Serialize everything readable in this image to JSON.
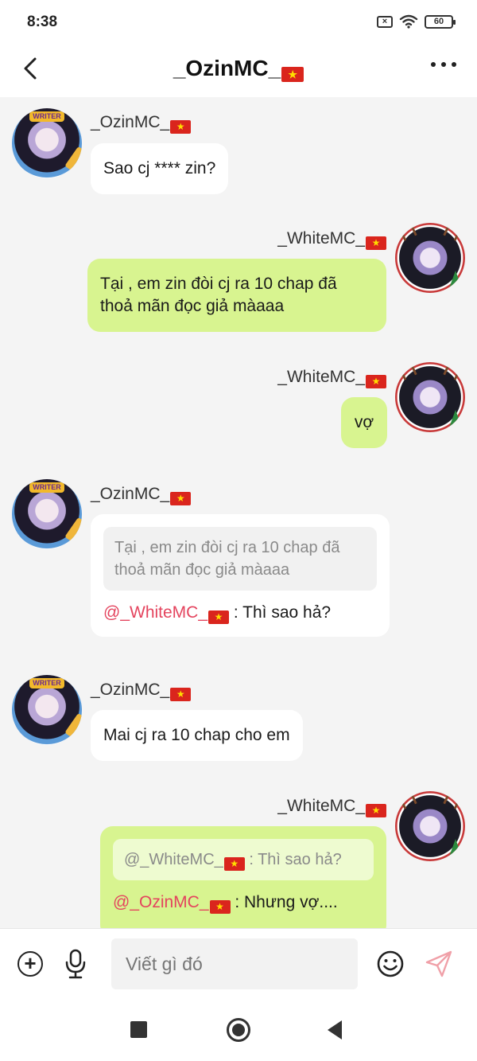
{
  "status_bar": {
    "time": "8:38",
    "x_icon": "x-box-icon",
    "wifi_icon": "wifi-icon",
    "battery": "60"
  },
  "header": {
    "title": "_OzinMC_",
    "back_icon": "chevron-left-icon",
    "more_icon": "more-dots-icon"
  },
  "flag_glyph": "★",
  "messages": [
    {
      "sender": "_OzinMC_",
      "side": "in",
      "text": "Sao cj **** zin?"
    },
    {
      "sender": "_WhiteMC_",
      "side": "out",
      "text": "Tại , em zin đòi cj ra 10 chap đã thoả mãn đọc giả màaaa"
    },
    {
      "sender": "_WhiteMC_",
      "side": "out",
      "text": "vợ"
    },
    {
      "sender": "_OzinMC_",
      "side": "in",
      "quote": "Tại , em zin đòi cj ra 10 chap đã thoả mãn đọc giả màaaa",
      "mention": "@_WhiteMC_",
      "text": " : Thì sao hả?"
    },
    {
      "sender": "_OzinMC_",
      "side": "in",
      "text": "Mai cj ra 10 chap cho em"
    },
    {
      "sender": "_WhiteMC_",
      "side": "out",
      "quote_name": "@_WhiteMC_",
      "quote_text": " : Thì sao hả?",
      "mention": "@_OzinMC_",
      "text": " : Nhưng vợ...."
    }
  ],
  "avatar_badge": "WRITER",
  "composer": {
    "placeholder": "Viết gì đó"
  },
  "colors": {
    "bubble_out": "#d8f490",
    "bubble_in": "#ffffff",
    "mention": "#e4445e",
    "flag_red": "#da251d",
    "flag_star": "#ffde00"
  }
}
